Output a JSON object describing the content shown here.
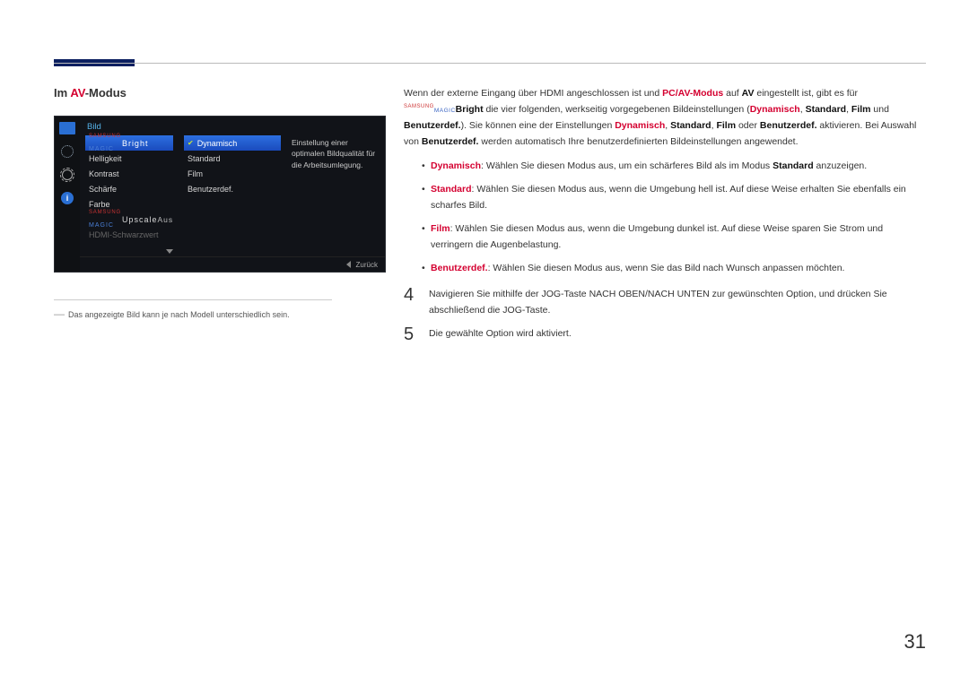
{
  "heading": {
    "prefix": "Im ",
    "av": "AV",
    "suffix": "-Modus"
  },
  "osd": {
    "title": "Bild",
    "col_a": {
      "magic_bright": {
        "samsung": "SAMSUNG",
        "magic": "MAGIC",
        "suffix": "Bright"
      },
      "helligkeit": "Helligkeit",
      "kontrast": "Kontrast",
      "schaerfe": "Schärfe",
      "farbe": "Farbe",
      "magic_upscale": {
        "samsung": "SAMSUNG",
        "magic": "MAGIC",
        "suffix": "Upscale"
      },
      "upscale_value": "Aus",
      "hdmi": "HDMI-Schwarzwert"
    },
    "col_b": {
      "dynamisch": "Dynamisch",
      "standard": "Standard",
      "film": "Film",
      "benutzerdef": "Benutzerdef."
    },
    "col_c": "Einstellung einer optimalen Bildqualität für die Arbeitsumlegung.",
    "footer": "Zurück"
  },
  "note": "Das angezeigte Bild kann je nach Modell unterschiedlich sein.",
  "intro": {
    "p1a": "Wenn der externe Eingang über HDMI angeschlossen ist und ",
    "pcav": "PC/AV-Modus",
    "p1b": " auf ",
    "av": "AV",
    "p1c": " eingestellt ist, gibt es für ",
    "magic_s": "SAMSUNG",
    "magic_m": "MAGIC",
    "bright": "Bright",
    "p2a": " die vier folgenden, werkseitig vorgegebenen Bildeinstellungen (",
    "dy": "Dynamisch",
    "sep1": ", ",
    "st": "Standard",
    "sep2": ", ",
    "fi": "Film",
    "und": " und ",
    "be": "Benutzerdef.",
    "p2b": "). Sie können eine der Einstellungen ",
    "dy2": "Dynamisch",
    "st2": "Standard",
    "fi2": "Film",
    "oder": " oder ",
    "be2": "Benutzerdef.",
    "p2c": " aktivieren. Bei Auswahl von ",
    "be3": "Benutzerdef.",
    "p2d": " werden automatisch Ihre benutzerdefinierten Bildeinstellungen angewendet."
  },
  "bullets": {
    "b1a": "Dynamisch",
    "b1b": ": Wählen Sie diesen Modus aus, um ein schärferes Bild als im Modus ",
    "b1c": "Standard",
    "b1d": " anzuzeigen.",
    "b2a": "Standard",
    "b2b": ": Wählen Sie diesen Modus aus, wenn die Umgebung hell ist. Auf diese Weise erhalten Sie ebenfalls ein scharfes Bild.",
    "b3a": "Film",
    "b3b": ": Wählen Sie diesen Modus aus, wenn die Umgebung dunkel ist. Auf diese Weise sparen Sie Strom und verringern die Augenbelastung.",
    "b4a": "Benutzerdef.",
    "b4b": ": Wählen Sie diesen Modus aus, wenn Sie das Bild nach Wunsch anpassen möchten."
  },
  "steps": {
    "s4n": "4",
    "s4t": "Navigieren Sie mithilfe der JOG-Taste NACH OBEN/NACH UNTEN zur gewünschten Option, und drücken Sie abschließend die JOG-Taste.",
    "s5n": "5",
    "s5t": "Die gewählte Option wird aktiviert."
  },
  "page_number": "31"
}
